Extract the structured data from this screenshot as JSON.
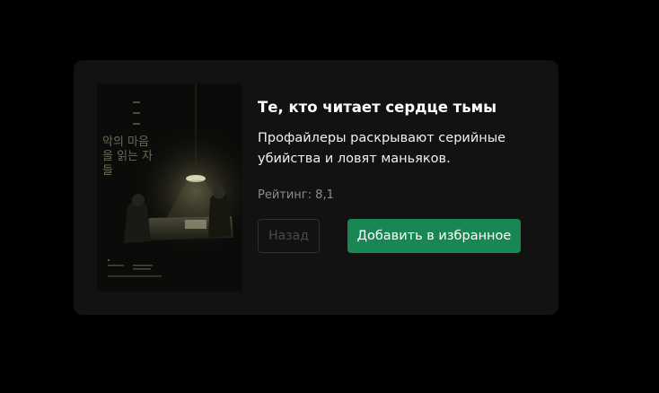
{
  "movie": {
    "title": "Те, кто читает сердце тьмы",
    "description": "Профайлеры раскрывают серийные убийства и ловят маньяков.",
    "rating_label": "Рейтинг:",
    "rating_value": "8,1",
    "poster_text": "악의 마음을 읽는 자들"
  },
  "actions": {
    "back_label": "Назад",
    "favorite_label": "Добавить в избранное"
  },
  "colors": {
    "page_background": "#000000",
    "card_background": "#121212",
    "accent_green": "#198754"
  }
}
